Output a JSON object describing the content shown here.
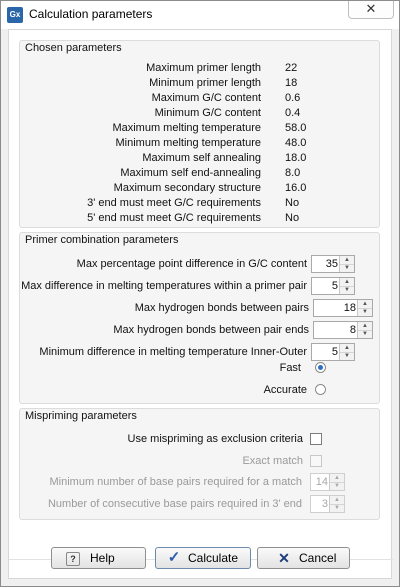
{
  "window": {
    "title": "Calculation parameters",
    "icon": "Gx",
    "close_glyph": "✕"
  },
  "chosen": {
    "title": "Chosen parameters",
    "rows": [
      {
        "label": "Maximum primer length",
        "value": "22"
      },
      {
        "label": "Minimum primer length",
        "value": "18"
      },
      {
        "label": "Maximum G/C content",
        "value": "0.6"
      },
      {
        "label": "Minimum G/C content",
        "value": "0.4"
      },
      {
        "label": "Maximum melting temperature",
        "value": "58.0"
      },
      {
        "label": "Minimum melting temperature",
        "value": "48.0"
      },
      {
        "label": "Maximum self annealing",
        "value": "18.0"
      },
      {
        "label": "Maximum self end-annealing",
        "value": "8.0"
      },
      {
        "label": "Maximum secondary structure",
        "value": "16.0"
      },
      {
        "label": "3' end must meet G/C requirements",
        "value": "No"
      },
      {
        "label": "5' end must meet G/C requirements",
        "value": "No"
      }
    ]
  },
  "combo": {
    "title": "Primer combination parameters",
    "rows": [
      {
        "label": "Max percentage point difference in G/C content",
        "value": "35"
      },
      {
        "label": "Max difference in melting temperatures within a primer pair",
        "value": "5"
      },
      {
        "label": "Max hydrogen bonds between pairs",
        "value": "18"
      },
      {
        "label": "Max hydrogen bonds between pair ends",
        "value": "8"
      },
      {
        "label": "Minimum difference in melting temperature Inner-Outer",
        "value": "5"
      }
    ],
    "fast_label": "Fast",
    "accurate_label": "Accurate",
    "fast_selected": true
  },
  "mispriming": {
    "title": "Mispriming parameters",
    "use_label": "Use mispriming as exclusion criteria",
    "use_checked": false,
    "exact_label": "Exact match",
    "exact_checked": false,
    "min_base_label": "Minimum number of base pairs required for a match",
    "min_base_value": "14",
    "consec_label": "Number of consecutive base pairs required in 3' end",
    "consec_value": "3"
  },
  "buttons": {
    "help_label": "Help",
    "help_icon": "?",
    "calculate_label": "Calculate",
    "calculate_icon": "✓",
    "cancel_label": "Cancel",
    "cancel_icon": "✕"
  },
  "colors": {
    "accent": "#2d6fc2",
    "check_icon": "#2a5caa",
    "cancel_icon": "#1d3d7a"
  }
}
